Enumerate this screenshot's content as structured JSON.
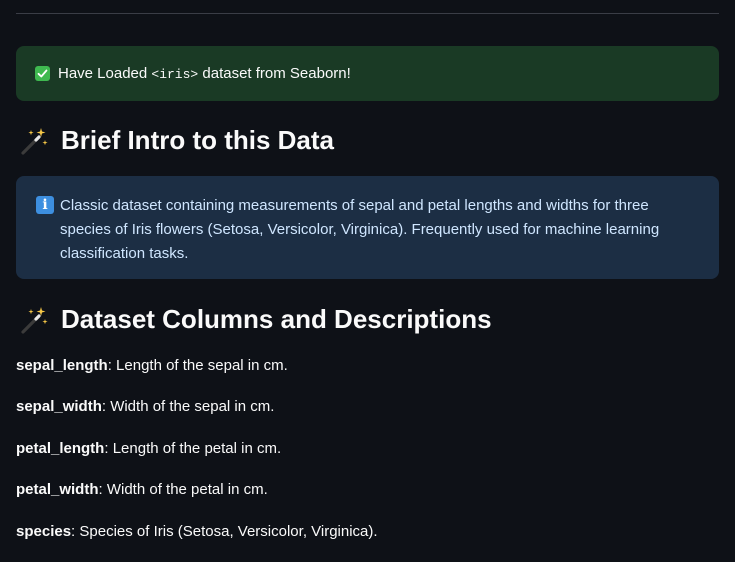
{
  "success": {
    "prefix": "Have Loaded ",
    "code": "<iris>",
    "suffix": " dataset from Seaborn!"
  },
  "intro": {
    "heading": "Brief Intro to this Data",
    "info": "Classic dataset containing measurements of sepal and petal lengths and widths for three species of Iris flowers (Setosa, Versicolor, Virginica). Frequently used for machine learning classification tasks."
  },
  "columns": {
    "heading": "Dataset Columns and Descriptions",
    "items": [
      {
        "name": "sepal_length",
        "desc": ": Length of the sepal in cm."
      },
      {
        "name": "sepal_width",
        "desc": ": Width of the sepal in cm."
      },
      {
        "name": "petal_length",
        "desc": ": Length of the petal in cm."
      },
      {
        "name": "petal_width",
        "desc": ": Width of the petal in cm."
      },
      {
        "name": "species",
        "desc": ": Species of Iris (Setosa, Versicolor, Virginica)."
      }
    ]
  },
  "icons": {
    "success": "check-box-icon",
    "info": "info-icon",
    "heading": "magic-wand-icon"
  },
  "colors": {
    "background": "#0e1117",
    "success_bg": "#1a3a25",
    "info_bg": "#1c2e44",
    "info_text": "#cfe6ff"
  }
}
